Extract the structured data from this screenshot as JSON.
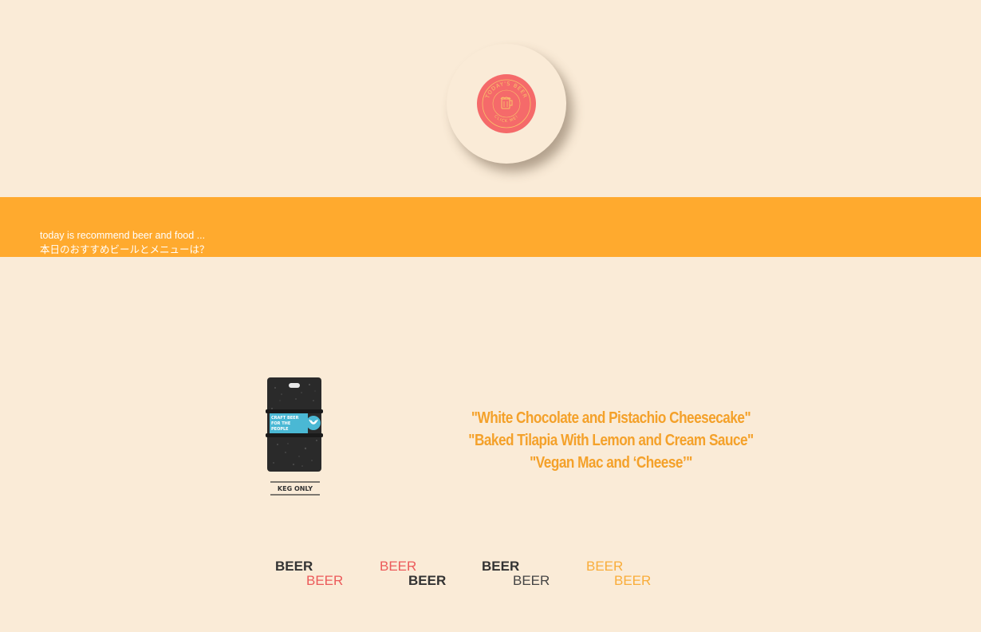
{
  "badge": {
    "ring_text_top": "TODAY'S BEER",
    "ring_text_bottom": "CLICK ME!",
    "icon": "beer-mug-icon"
  },
  "band": {
    "line1": "today is recommend beer and food ...",
    "line2": "本日のおすすめビールとメニューは？"
  },
  "keg": {
    "label_line1": "CRAFT BEER",
    "label_line2": "FOR THE",
    "label_line3": "PEOPLE",
    "footer": "KEG ONLY"
  },
  "menu": {
    "items": [
      "\"White Chocolate and Pistachio Cheesecake\"",
      "\"Baked Tilapia With Lemon and Cream Sauce\"",
      "\"Vegan Mac and ‘Cheese’\""
    ]
  },
  "beer_words": {
    "w1": "BEER",
    "w2": "BEER",
    "w3": "BEER",
    "w4": "BEER",
    "w5": "BEER",
    "w6": "BEER",
    "w7": "BEER",
    "w8": "BEER"
  },
  "colors": {
    "background": "#faebd7",
    "band": "#ffaa2e",
    "badge": "#f56a6a",
    "menu_text": "#f4a12a",
    "keg_label": "#4ab8d4"
  }
}
